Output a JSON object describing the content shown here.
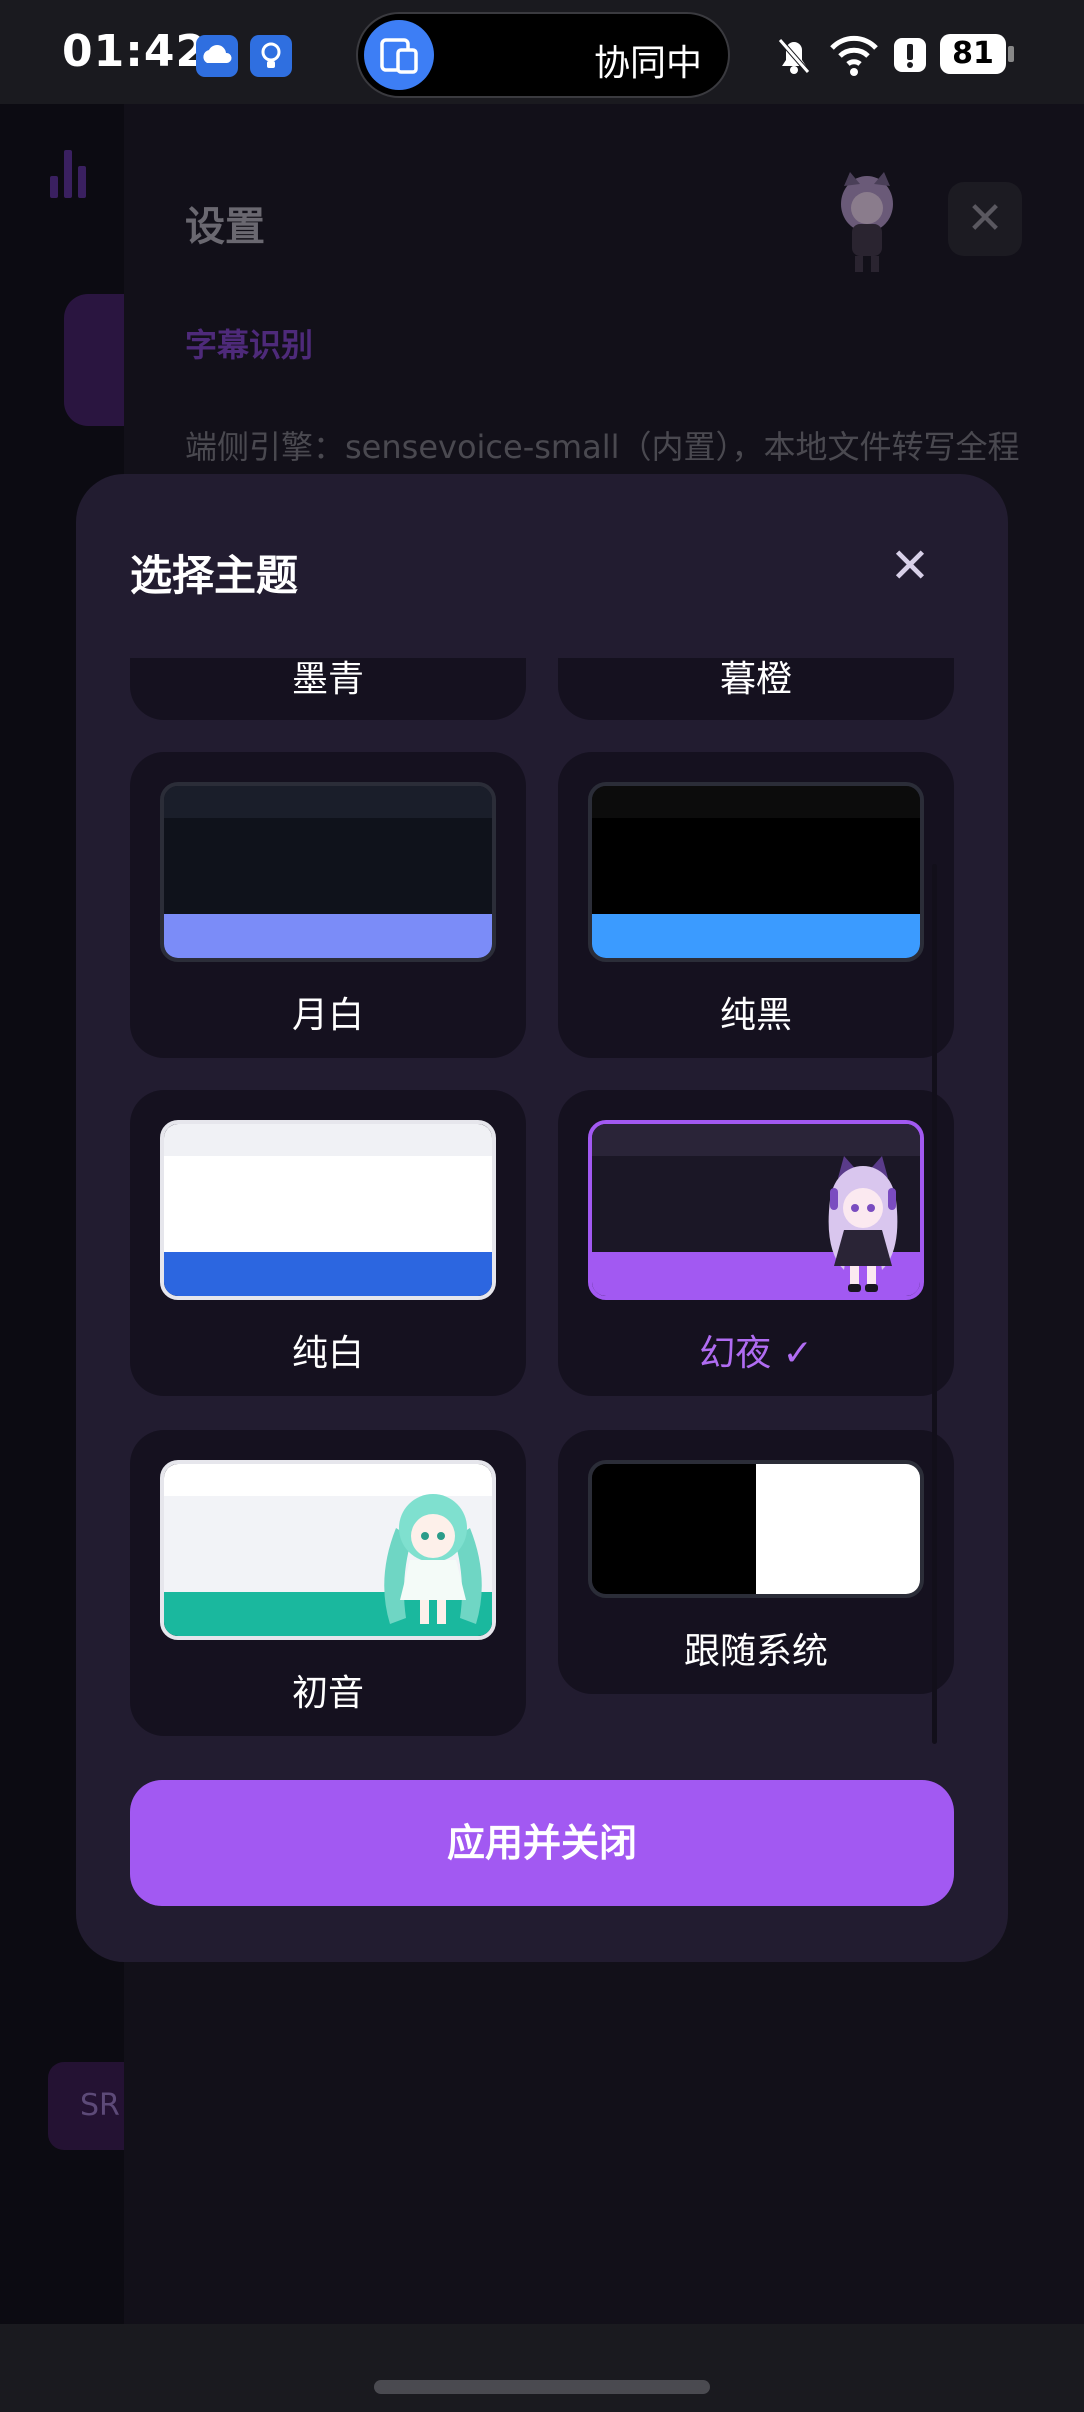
{
  "status_bar": {
    "time": "01:42",
    "collab_label": "协同中",
    "battery": "81"
  },
  "background": {
    "title": "设置",
    "section": "字幕识别",
    "description": "端侧引擎：sensevoice-small（内置），本地文件转写全程",
    "srt_label": "SR"
  },
  "modal": {
    "title": "选择主题",
    "apply_label": "应用并关闭",
    "themes": [
      {
        "label": "墨青",
        "partial": true
      },
      {
        "label": "暮橙",
        "partial": true
      },
      {
        "label": "月白",
        "colors": {
          "top": "#1a1e2a",
          "mid": "#0f121b",
          "bot": "#7b8cf8"
        }
      },
      {
        "label": "纯黑",
        "colors": {
          "top": "#0c0c0c",
          "mid": "#000000",
          "bot": "#3b9bff"
        }
      },
      {
        "label": "纯白",
        "colors": {
          "top": "#f0f1f5",
          "mid": "#ffffff",
          "bot": "#2c66e0"
        }
      },
      {
        "label": "幻夜 ✓",
        "selected": true,
        "colors": {
          "top": "#2a2438",
          "mid": "#1b1726",
          "bot": "#a259f2"
        }
      },
      {
        "label": "初音",
        "colors": {
          "top": "#ffffff",
          "mid": "#f2f3f7",
          "bot": "#1ab89e"
        }
      },
      {
        "label": "跟随系统",
        "colors": {
          "left": "#000000",
          "right": "#ffffff"
        }
      }
    ]
  },
  "colors": {
    "accent": "#a259f2",
    "modal_bg": "#221c30",
    "card_bg": "#15111f"
  }
}
